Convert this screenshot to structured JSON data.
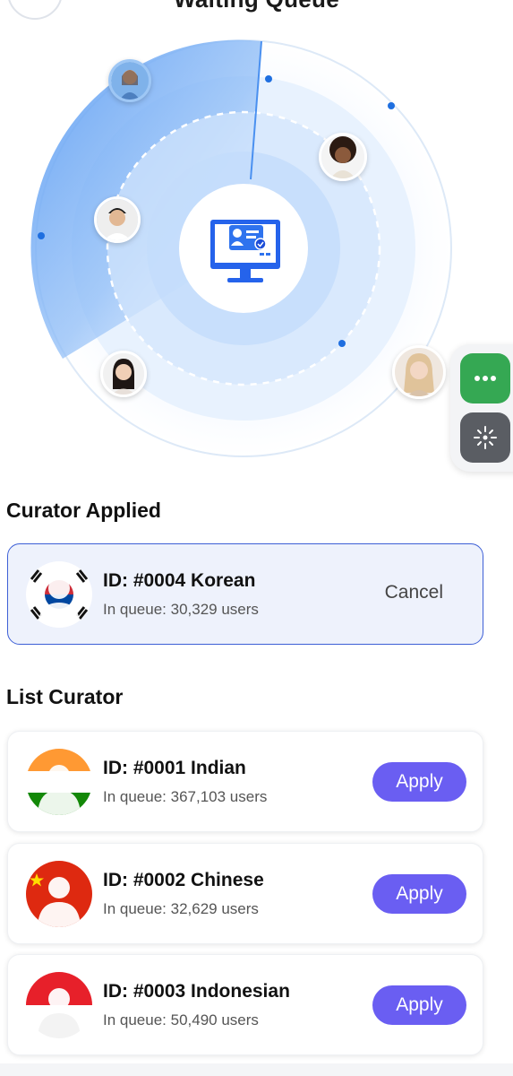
{
  "header": {
    "title": "Waiting Queue"
  },
  "radar": {
    "center_icon": "monitor-profile-check-icon",
    "colors": {
      "sweep": "#4a90f0",
      "ring_light": "#e8f2fe",
      "ring_mid": "#d3e6fc",
      "dot": "#1f6fe0"
    }
  },
  "side_actions": {
    "more_icon": "more-dots-icon",
    "move_icon": "drag-move-icon",
    "more_color": "#35a853",
    "move_color": "#5a5d63"
  },
  "applied": {
    "section_title": "Curator Applied",
    "item": {
      "id": "ID: #0004 Korean",
      "queue": "In queue: 30,329 users",
      "action": "Cancel",
      "flag": "korea"
    }
  },
  "list": {
    "section_title": "List Curator",
    "items": [
      {
        "id": "ID: #0001 Indian",
        "queue": "In queue: 367,103 users",
        "action": "Apply",
        "flag": "india"
      },
      {
        "id": "ID: #0002 Chinese",
        "queue": "In queue: 32,629 users",
        "action": "Apply",
        "flag": "china"
      },
      {
        "id": "ID: #0003 Indonesian",
        "queue": "In queue: 50,490 users",
        "action": "Apply",
        "flag": "indonesia"
      }
    ]
  },
  "colors": {
    "accent": "#6a5ef2",
    "applied_border": "#3d5fd6",
    "applied_bg": "#eef2fc"
  }
}
